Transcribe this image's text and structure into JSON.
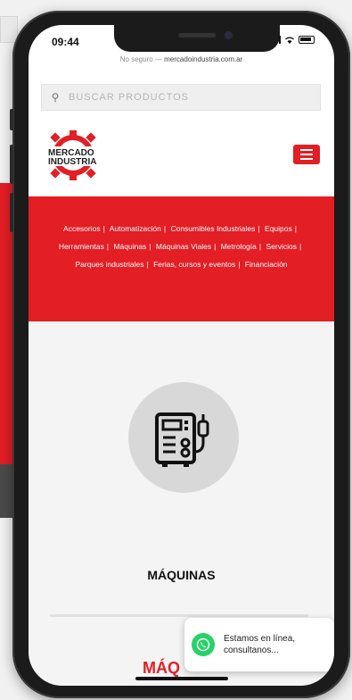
{
  "status_bar": {
    "time": "09:44"
  },
  "browser": {
    "url_prefix": "No seguro —",
    "url_domain": "mercadoindustria.com.ar"
  },
  "search": {
    "placeholder": "BUSCAR PRODUCTOS"
  },
  "logo": {
    "line1": "MERCADO",
    "line2": "INDUSTRIA"
  },
  "categories": [
    "Accesorios",
    "Automatización",
    "Consumibles Industriales",
    "Equipos",
    "Herramientas",
    "Máquinas",
    "Máquinas Viales",
    "Metrología",
    "Servicios",
    "Parques industriales",
    "Ferias, cursos y eventos",
    "Financiación"
  ],
  "product": {
    "title": "MÁQUINAS",
    "section_heading": "MÁQ"
  },
  "chat": {
    "message": "Estamos en línea, consultanos..."
  },
  "colors": {
    "brand_red": "#e31e24",
    "whatsapp_green": "#25d366"
  },
  "icons": [
    "search-icon",
    "menu-icon",
    "machine-icon",
    "whatsapp-icon"
  ]
}
